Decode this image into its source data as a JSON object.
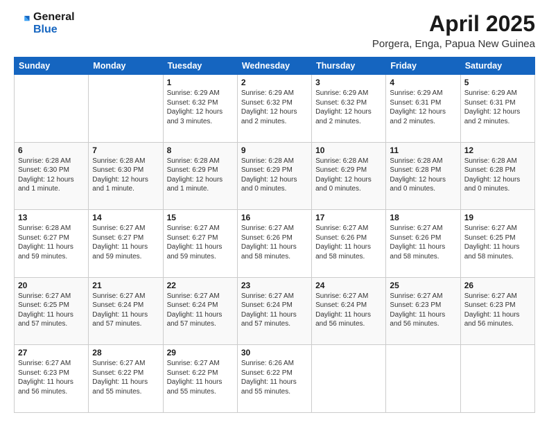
{
  "header": {
    "logo_line1": "General",
    "logo_line2": "Blue",
    "title": "April 2025",
    "subtitle": "Porgera, Enga, Papua New Guinea"
  },
  "weekdays": [
    "Sunday",
    "Monday",
    "Tuesday",
    "Wednesday",
    "Thursday",
    "Friday",
    "Saturday"
  ],
  "weeks": [
    [
      {
        "day": "",
        "info": ""
      },
      {
        "day": "",
        "info": ""
      },
      {
        "day": "1",
        "info": "Sunrise: 6:29 AM\nSunset: 6:32 PM\nDaylight: 12 hours\nand 3 minutes."
      },
      {
        "day": "2",
        "info": "Sunrise: 6:29 AM\nSunset: 6:32 PM\nDaylight: 12 hours\nand 2 minutes."
      },
      {
        "day": "3",
        "info": "Sunrise: 6:29 AM\nSunset: 6:32 PM\nDaylight: 12 hours\nand 2 minutes."
      },
      {
        "day": "4",
        "info": "Sunrise: 6:29 AM\nSunset: 6:31 PM\nDaylight: 12 hours\nand 2 minutes."
      },
      {
        "day": "5",
        "info": "Sunrise: 6:29 AM\nSunset: 6:31 PM\nDaylight: 12 hours\nand 2 minutes."
      }
    ],
    [
      {
        "day": "6",
        "info": "Sunrise: 6:28 AM\nSunset: 6:30 PM\nDaylight: 12 hours\nand 1 minute."
      },
      {
        "day": "7",
        "info": "Sunrise: 6:28 AM\nSunset: 6:30 PM\nDaylight: 12 hours\nand 1 minute."
      },
      {
        "day": "8",
        "info": "Sunrise: 6:28 AM\nSunset: 6:29 PM\nDaylight: 12 hours\nand 1 minute."
      },
      {
        "day": "9",
        "info": "Sunrise: 6:28 AM\nSunset: 6:29 PM\nDaylight: 12 hours\nand 0 minutes."
      },
      {
        "day": "10",
        "info": "Sunrise: 6:28 AM\nSunset: 6:29 PM\nDaylight: 12 hours\nand 0 minutes."
      },
      {
        "day": "11",
        "info": "Sunrise: 6:28 AM\nSunset: 6:28 PM\nDaylight: 12 hours\nand 0 minutes."
      },
      {
        "day": "12",
        "info": "Sunrise: 6:28 AM\nSunset: 6:28 PM\nDaylight: 12 hours\nand 0 minutes."
      }
    ],
    [
      {
        "day": "13",
        "info": "Sunrise: 6:28 AM\nSunset: 6:27 PM\nDaylight: 11 hours\nand 59 minutes."
      },
      {
        "day": "14",
        "info": "Sunrise: 6:27 AM\nSunset: 6:27 PM\nDaylight: 11 hours\nand 59 minutes."
      },
      {
        "day": "15",
        "info": "Sunrise: 6:27 AM\nSunset: 6:27 PM\nDaylight: 11 hours\nand 59 minutes."
      },
      {
        "day": "16",
        "info": "Sunrise: 6:27 AM\nSunset: 6:26 PM\nDaylight: 11 hours\nand 58 minutes."
      },
      {
        "day": "17",
        "info": "Sunrise: 6:27 AM\nSunset: 6:26 PM\nDaylight: 11 hours\nand 58 minutes."
      },
      {
        "day": "18",
        "info": "Sunrise: 6:27 AM\nSunset: 6:26 PM\nDaylight: 11 hours\nand 58 minutes."
      },
      {
        "day": "19",
        "info": "Sunrise: 6:27 AM\nSunset: 6:25 PM\nDaylight: 11 hours\nand 58 minutes."
      }
    ],
    [
      {
        "day": "20",
        "info": "Sunrise: 6:27 AM\nSunset: 6:25 PM\nDaylight: 11 hours\nand 57 minutes."
      },
      {
        "day": "21",
        "info": "Sunrise: 6:27 AM\nSunset: 6:24 PM\nDaylight: 11 hours\nand 57 minutes."
      },
      {
        "day": "22",
        "info": "Sunrise: 6:27 AM\nSunset: 6:24 PM\nDaylight: 11 hours\nand 57 minutes."
      },
      {
        "day": "23",
        "info": "Sunrise: 6:27 AM\nSunset: 6:24 PM\nDaylight: 11 hours\nand 57 minutes."
      },
      {
        "day": "24",
        "info": "Sunrise: 6:27 AM\nSunset: 6:24 PM\nDaylight: 11 hours\nand 56 minutes."
      },
      {
        "day": "25",
        "info": "Sunrise: 6:27 AM\nSunset: 6:23 PM\nDaylight: 11 hours\nand 56 minutes."
      },
      {
        "day": "26",
        "info": "Sunrise: 6:27 AM\nSunset: 6:23 PM\nDaylight: 11 hours\nand 56 minutes."
      }
    ],
    [
      {
        "day": "27",
        "info": "Sunrise: 6:27 AM\nSunset: 6:23 PM\nDaylight: 11 hours\nand 56 minutes."
      },
      {
        "day": "28",
        "info": "Sunrise: 6:27 AM\nSunset: 6:22 PM\nDaylight: 11 hours\nand 55 minutes."
      },
      {
        "day": "29",
        "info": "Sunrise: 6:27 AM\nSunset: 6:22 PM\nDaylight: 11 hours\nand 55 minutes."
      },
      {
        "day": "30",
        "info": "Sunrise: 6:26 AM\nSunset: 6:22 PM\nDaylight: 11 hours\nand 55 minutes."
      },
      {
        "day": "",
        "info": ""
      },
      {
        "day": "",
        "info": ""
      },
      {
        "day": "",
        "info": ""
      }
    ]
  ]
}
